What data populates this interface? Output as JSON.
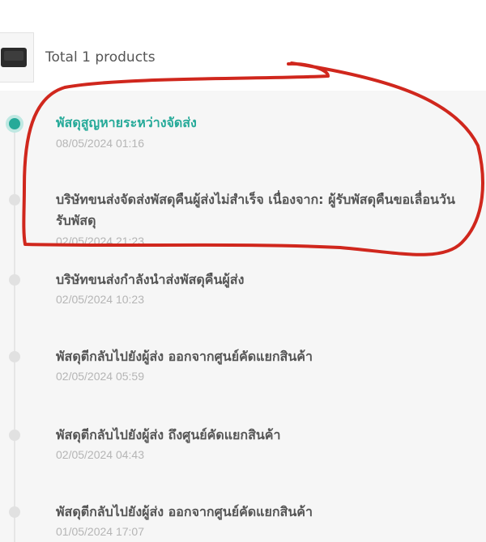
{
  "product_summary": {
    "label": "Total 1 products"
  },
  "events": [
    {
      "title": "พัสดุสูญหายระหว่างจัดส่ง",
      "time": "08/05/2024 01:16",
      "active": true
    },
    {
      "title": "บริษัทขนส่งจัดส่งพัสดุคืนผู้ส่งไม่สำเร็จ เนื่องจาก: ผู้รับพัสดุคืนขอเลื่อนวันรับพัสดุ",
      "time": "02/05/2024 21:23",
      "active": false
    },
    {
      "title": "บริษัทขนส่งกำลังนำส่งพัสดุคืนผู้ส่ง",
      "time": "02/05/2024 10:23",
      "active": false
    },
    {
      "title": "พัสดุตีกลับไปยังผู้ส่ง ออกจากศูนย์คัดแยกสินค้า",
      "time": "02/05/2024 05:59",
      "active": false
    },
    {
      "title": "พัสดุตีกลับไปยังผู้ส่ง ถึงศูนย์คัดแยกสินค้า",
      "time": "02/05/2024 04:43",
      "active": false
    },
    {
      "title": "พัสดุตีกลับไปยังผู้ส่ง ออกจากศูนย์คัดแยกสินค้า",
      "time": "01/05/2024 17:07",
      "active": false
    }
  ],
  "colors": {
    "active": "#26aa99",
    "annotation": "#d0271d",
    "text": "#555555",
    "muted": "#b5b5b5"
  }
}
